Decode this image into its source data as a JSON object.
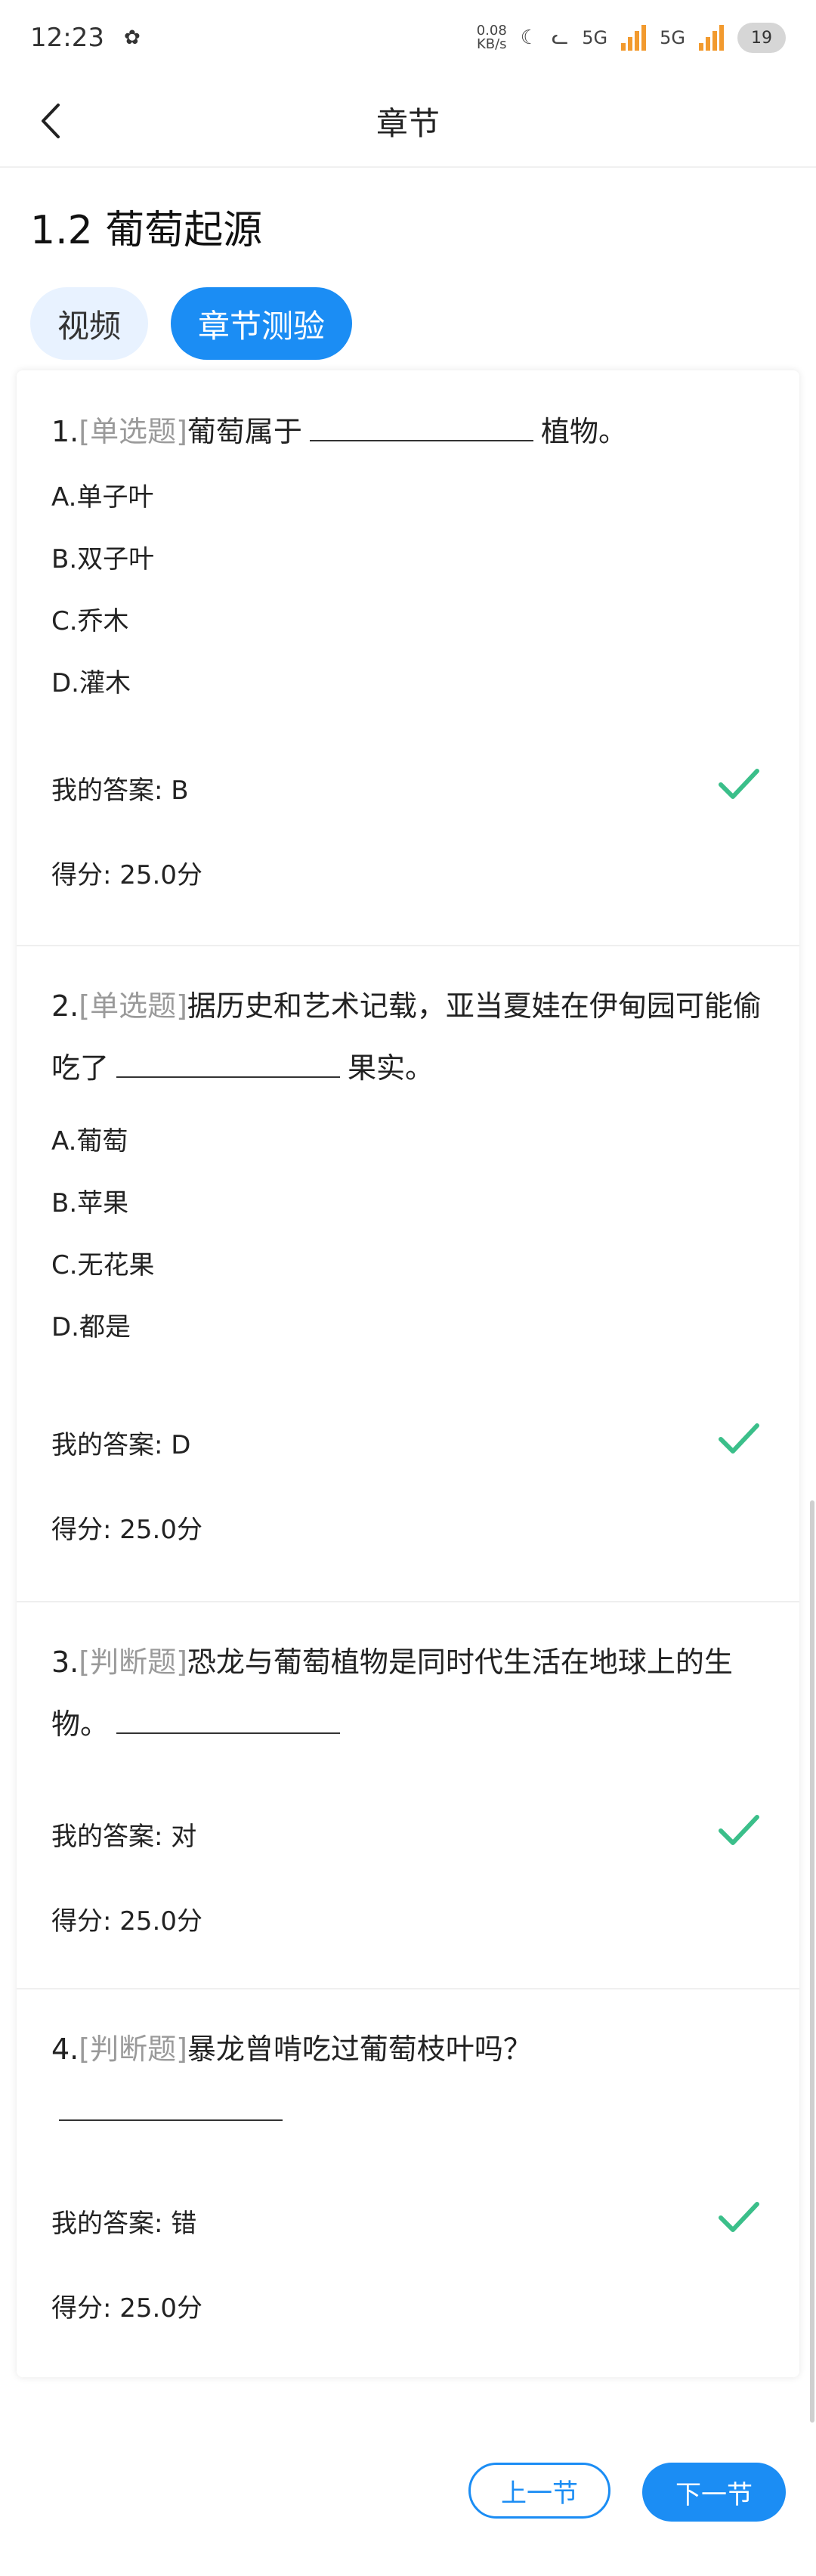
{
  "status_bar": {
    "time": "12:23",
    "net_speed_value": "0.08",
    "net_speed_unit": "KB/s",
    "network1": "5G",
    "network2": "5G",
    "battery": "19"
  },
  "header": {
    "title": "章节"
  },
  "section": {
    "title": "1.2 葡萄起源"
  },
  "tabs": [
    {
      "label": "视频",
      "active": false
    },
    {
      "label": "章节测验",
      "active": true
    }
  ],
  "questions": [
    {
      "number": "1.",
      "type": "[单选题]",
      "text_before": "葡萄属于",
      "text_after": "植物。",
      "options": [
        "A.单子叶",
        "B.双子叶",
        "C.乔木",
        "D.灌木"
      ],
      "my_answer": "我的答案: B",
      "score": "得分: 25.0分",
      "correct": true
    },
    {
      "number": "2.",
      "type": "[单选题]",
      "text_before": "据历史和艺术记载，亚当夏娃在伊甸园可能偷吃了",
      "text_after": "果实。",
      "options": [
        "A.葡萄",
        "B.苹果",
        "C.无花果",
        "D.都是"
      ],
      "my_answer": "我的答案: D",
      "score": "得分: 25.0分",
      "correct": true
    },
    {
      "number": "3.",
      "type": "[判断题]",
      "text_before": "恐龙与葡萄植物是同时代生活在地球上的生物。",
      "text_after": "",
      "options": [],
      "my_answer": "我的答案: 对",
      "score": "得分: 25.0分",
      "correct": true
    },
    {
      "number": "4.",
      "type": "[判断题]",
      "text_before": "暴龙曾啃吃过葡萄枝叶吗？",
      "text_after": "",
      "options": [],
      "my_answer": "我的答案: 错",
      "score": "得分: 25.0分",
      "correct": true
    }
  ],
  "nav": {
    "prev_label": "上一节",
    "next_label": "下一节"
  },
  "colors": {
    "accent": "#1b8df4",
    "check": "#3bbf8a",
    "tab_inactive_bg": "#e8f2ff"
  }
}
